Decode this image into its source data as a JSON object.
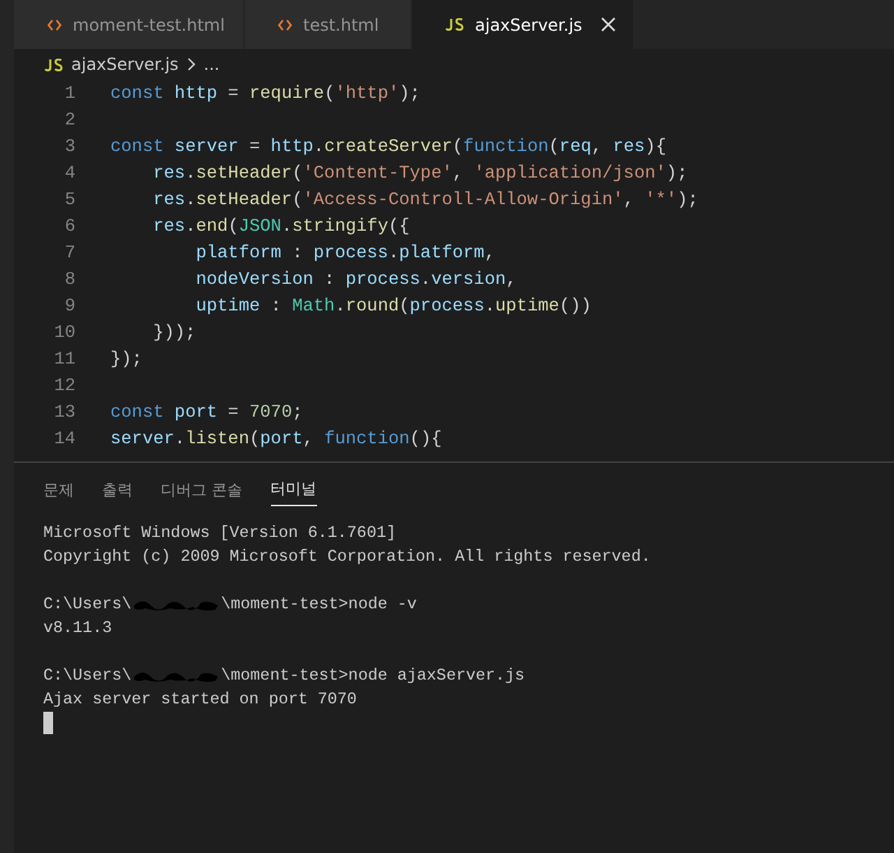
{
  "tabs": [
    {
      "label": "moment-test.html",
      "kind": "html",
      "selected": false
    },
    {
      "label": "test.html",
      "kind": "html",
      "selected": false
    },
    {
      "label": "ajaxServer.js",
      "kind": "js",
      "selected": true
    }
  ],
  "breadcrumb": {
    "file": "ajaxServer.js",
    "rest": "..."
  },
  "editor": {
    "lines": [
      {
        "number": "1",
        "tokens": [
          {
            "kind": "kw",
            "text": "const"
          },
          {
            "kind": "var",
            "text": " http"
          },
          {
            "kind": "p",
            "text": " = "
          },
          {
            "kind": "fn",
            "text": "require"
          },
          {
            "kind": "p",
            "text": "("
          },
          {
            "kind": "str",
            "text": "'http'"
          },
          {
            "kind": "p",
            "text": ");"
          }
        ]
      },
      {
        "number": "2"
      },
      {
        "number": "3",
        "tokens": [
          {
            "kind": "kw",
            "text": "const"
          },
          {
            "kind": "var",
            "text": " server"
          },
          {
            "kind": "p",
            "text": " = "
          },
          {
            "kind": "var",
            "text": "http"
          },
          {
            "kind": "p",
            "text": "."
          },
          {
            "kind": "fn",
            "text": "createServer"
          },
          {
            "kind": "p",
            "text": "("
          },
          {
            "kind": "kw",
            "text": "function"
          },
          {
            "kind": "p",
            "text": "("
          },
          {
            "kind": "var",
            "text": "req"
          },
          {
            "kind": "p",
            "text": ", "
          },
          {
            "kind": "var",
            "text": "res"
          },
          {
            "kind": "p",
            "text": "){"
          }
        ]
      },
      {
        "number": "4",
        "tokens": [
          {
            "kind": "var",
            "text": "    res"
          },
          {
            "kind": "p",
            "text": "."
          },
          {
            "kind": "fn",
            "text": "setHeader"
          },
          {
            "kind": "p",
            "text": "("
          },
          {
            "kind": "str",
            "text": "'Content-Type'"
          },
          {
            "kind": "p",
            "text": ", "
          },
          {
            "kind": "str",
            "text": "'application/json'"
          },
          {
            "kind": "p",
            "text": ");"
          }
        ]
      },
      {
        "number": "5",
        "tokens": [
          {
            "kind": "var",
            "text": "    res"
          },
          {
            "kind": "p",
            "text": "."
          },
          {
            "kind": "fn",
            "text": "setHeader"
          },
          {
            "kind": "p",
            "text": "("
          },
          {
            "kind": "str",
            "text": "'Access-Controll-Allow-Origin'"
          },
          {
            "kind": "p",
            "text": ", "
          },
          {
            "kind": "str",
            "text": "'*'"
          },
          {
            "kind": "p",
            "text": ");"
          }
        ]
      },
      {
        "number": "6",
        "tokens": [
          {
            "kind": "var",
            "text": "    res"
          },
          {
            "kind": "p",
            "text": "."
          },
          {
            "kind": "fn",
            "text": "end"
          },
          {
            "kind": "p",
            "text": "("
          },
          {
            "kind": "cls",
            "text": "JSON"
          },
          {
            "kind": "p",
            "text": "."
          },
          {
            "kind": "fn",
            "text": "stringify"
          },
          {
            "kind": "p",
            "text": "({"
          }
        ]
      },
      {
        "number": "7",
        "tokens": [
          {
            "kind": "var",
            "text": "        platform"
          },
          {
            "kind": "p",
            "text": " : "
          },
          {
            "kind": "var",
            "text": "process"
          },
          {
            "kind": "p",
            "text": "."
          },
          {
            "kind": "var",
            "text": "platform"
          },
          {
            "kind": "p",
            "text": ","
          }
        ]
      },
      {
        "number": "8",
        "tokens": [
          {
            "kind": "var",
            "text": "        nodeVersion"
          },
          {
            "kind": "p",
            "text": " : "
          },
          {
            "kind": "var",
            "text": "process"
          },
          {
            "kind": "p",
            "text": "."
          },
          {
            "kind": "var",
            "text": "version"
          },
          {
            "kind": "p",
            "text": ","
          }
        ]
      },
      {
        "number": "9",
        "tokens": [
          {
            "kind": "var",
            "text": "        uptime"
          },
          {
            "kind": "p",
            "text": " : "
          },
          {
            "kind": "cls",
            "text": "Math"
          },
          {
            "kind": "p",
            "text": "."
          },
          {
            "kind": "fn",
            "text": "round"
          },
          {
            "kind": "p",
            "text": "("
          },
          {
            "kind": "var",
            "text": "process"
          },
          {
            "kind": "p",
            "text": "."
          },
          {
            "kind": "fn",
            "text": "uptime"
          },
          {
            "kind": "p",
            "text": "())"
          }
        ]
      },
      {
        "number": "10",
        "tokens": [
          {
            "kind": "p",
            "text": "    }));"
          }
        ]
      },
      {
        "number": "11",
        "tokens": [
          {
            "kind": "p",
            "text": "});"
          }
        ]
      },
      {
        "number": "12"
      },
      {
        "number": "13",
        "tokens": [
          {
            "kind": "kw",
            "text": "const"
          },
          {
            "kind": "var",
            "text": " port"
          },
          {
            "kind": "p",
            "text": " = "
          },
          {
            "kind": "num",
            "text": "7070"
          },
          {
            "kind": "p",
            "text": ";"
          }
        ]
      },
      {
        "number": "14",
        "tokens": [
          {
            "kind": "var",
            "text": "server"
          },
          {
            "kind": "p",
            "text": "."
          },
          {
            "kind": "fn",
            "text": "listen"
          },
          {
            "kind": "p",
            "text": "("
          },
          {
            "kind": "var",
            "text": "port"
          },
          {
            "kind": "p",
            "text": ", "
          },
          {
            "kind": "kw",
            "text": "function"
          },
          {
            "kind": "p",
            "text": "(){"
          }
        ]
      }
    ]
  },
  "panel": {
    "tabs": [
      {
        "label": "문제",
        "selected": false
      },
      {
        "label": "출력",
        "selected": false
      },
      {
        "label": "디버그 콘솔",
        "selected": false
      },
      {
        "label": "터미널",
        "selected": true
      }
    ],
    "terminal": [
      {
        "parts": [
          {
            "text": "Microsoft Windows [Version 6.1.7601]"
          }
        ]
      },
      {
        "parts": [
          {
            "text": "Copyright (c) 2009 Microsoft Corporation. All rights reserved."
          }
        ]
      },
      {
        "kind": "blank"
      },
      {
        "parts": [
          {
            "text": "C:\\Users\\"
          },
          {
            "redacted": true
          },
          {
            "text": "\\moment-test>node -v"
          }
        ]
      },
      {
        "parts": [
          {
            "text": "v8.11.3"
          }
        ]
      },
      {
        "kind": "blank"
      },
      {
        "parts": [
          {
            "text": "C:\\Users\\"
          },
          {
            "redacted": true
          },
          {
            "text": "\\moment-test>node ajaxServer.js"
          }
        ]
      },
      {
        "parts": [
          {
            "text": "Ajax server started on port 7070"
          }
        ]
      }
    ]
  }
}
